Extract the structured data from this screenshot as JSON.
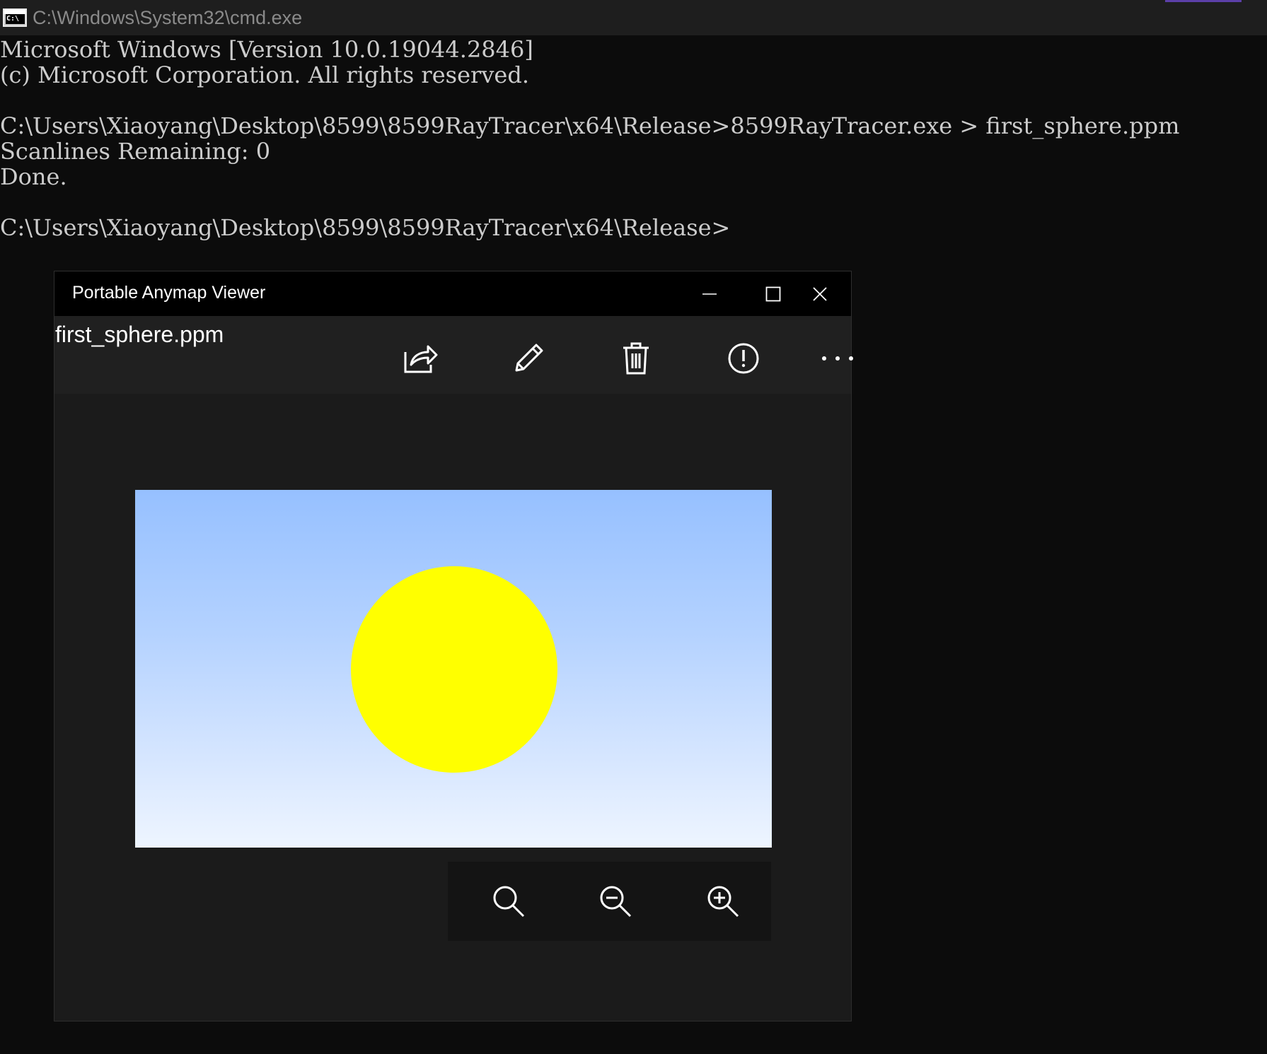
{
  "cmd": {
    "icon_label": "C:\\",
    "title": "C:\\Windows\\System32\\cmd.exe",
    "lines": [
      "Microsoft Windows [Version 10.0.19044.2846]",
      "(c) Microsoft Corporation. All rights reserved.",
      "",
      "C:\\Users\\Xiaoyang\\Desktop\\8599\\8599RayTracer\\x64\\Release>8599RayTracer.exe > first_sphere.ppm",
      "Scanlines Remaining: 0",
      "Done.",
      "",
      "C:\\Users\\Xiaoyang\\Desktop\\8599\\8599RayTracer\\x64\\Release>"
    ]
  },
  "viewer": {
    "title": "Portable Anymap Viewer",
    "filename": "first_sphere.ppm",
    "window_controls": [
      "minimize-icon",
      "maximize-icon",
      "close-icon"
    ],
    "toolbar": [
      "share-icon",
      "edit-pencil-icon",
      "delete-trash-icon",
      "info-icon",
      "more-options-icon"
    ],
    "zoom_controls": [
      "zoom-fit-icon",
      "zoom-out-icon",
      "zoom-in-icon"
    ],
    "image": {
      "sky_top_color": "#96c0ff",
      "sky_bottom_color": "#eef5ff",
      "sphere_color": "#ffff00"
    }
  }
}
